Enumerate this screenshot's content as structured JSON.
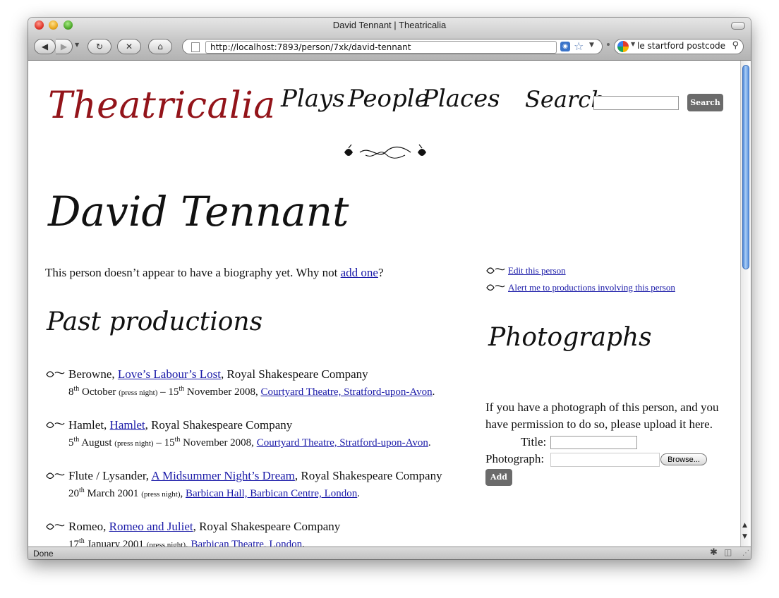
{
  "window": {
    "title": "David Tennant | Theatricalia",
    "url": "http://localhost:7893/person/7xk/david-tennant",
    "search_value": "le startford postcode",
    "status": "Done"
  },
  "site": {
    "logo": "Theatricalia",
    "nav": {
      "plays": "Plays",
      "people": "People",
      "places": "Places"
    },
    "search_label": "Search:",
    "search_button": "Search"
  },
  "person": {
    "name": "David Tennant",
    "bio_text": "This person doesn’t appear to have a biography yet. Why not ",
    "bio_link": "add one",
    "bio_end": "?"
  },
  "past_productions": {
    "heading": "Past productions",
    "items": [
      {
        "role": "Berowne, ",
        "play": "Love’s Labour’s Lost",
        "company": ", Royal Shakespeare Company",
        "start_day": "8",
        "start_sup": "th",
        "start_month": " October ",
        "press_night": "(press night)",
        "dash": " – ",
        "end_day": "15",
        "end_sup": "th",
        "end_month": " November 2008, ",
        "venue": "Courtyard Theatre, Stratford-upon-Avon",
        "end": "."
      },
      {
        "role": "Hamlet, ",
        "play": "Hamlet",
        "company": ", Royal Shakespeare Company",
        "start_day": "5",
        "start_sup": "th",
        "start_month": " August ",
        "press_night": "(press night)",
        "dash": " – ",
        "end_day": "15",
        "end_sup": "th",
        "end_month": " November 2008, ",
        "venue": "Courtyard Theatre, Stratford-upon-Avon",
        "end": "."
      },
      {
        "role": "Flute / Lysander, ",
        "play": "A Midsummer Night’s Dream",
        "company": ", Royal Shakespeare Company",
        "start_day": "20",
        "start_sup": "th",
        "start_month": " March 2001 ",
        "press_night": "(press night)",
        "dash": "",
        "end_day": "",
        "end_sup": "",
        "end_month": ", ",
        "venue": "Barbican Hall, Barbican Centre, London",
        "end": "."
      },
      {
        "role": "Romeo, ",
        "play": "Romeo and Juliet",
        "company": ", Royal Shakespeare Company",
        "start_day": "17",
        "start_sup": "th",
        "start_month": " January 2001 ",
        "press_night": "(press night)",
        "dash": "",
        "end_day": "",
        "end_sup": "",
        "end_month": ", ",
        "venue": "Barbican Theatre, London",
        "end": "."
      }
    ]
  },
  "sidebar": {
    "edit_link": "Edit this person",
    "alert_link": "Alert me to productions involving this person",
    "photos_heading": "Photographs",
    "photos_text": "If you have a photograph of this person, and you have permission to do so, please upload it here.",
    "title_label": "Title:",
    "photo_label": "Photograph:",
    "browse_button": "Browse...",
    "add_button": "Add"
  },
  "colors": {
    "logo": "#93141a",
    "link": "#1a1aa8",
    "button": "#6b6b6b"
  }
}
